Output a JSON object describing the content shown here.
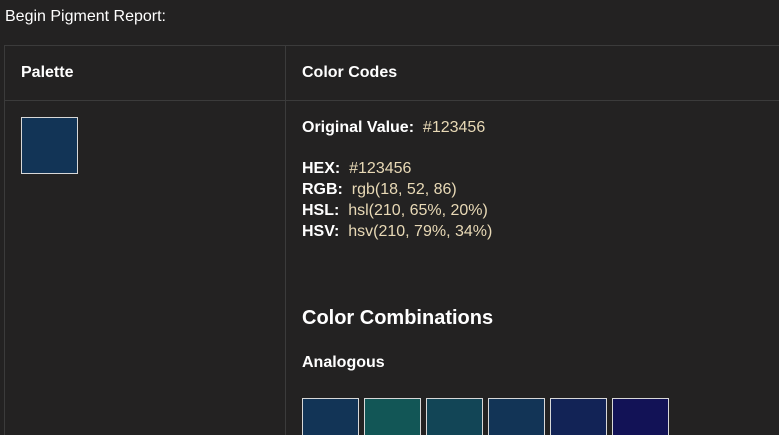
{
  "intro_text": "Begin Pigment Report:",
  "table": {
    "headers": {
      "palette": "Palette",
      "color_codes": "Color Codes"
    }
  },
  "main_color": "#123456",
  "codes": {
    "original": {
      "label": "Original Value:",
      "value": "#123456"
    },
    "hex": {
      "label": "HEX:",
      "value": "#123456"
    },
    "rgb": {
      "label": "RGB:",
      "value": "rgb(18, 52, 86)"
    },
    "hsl": {
      "label": "HSL:",
      "value": "hsl(210, 65%, 20%)"
    },
    "hsv": {
      "label": "HSV:",
      "value": "hsv(210, 79%, 34%)"
    }
  },
  "combinations": {
    "title": "Color Combinations",
    "analogous": {
      "title": "Analogous",
      "swatches": [
        "#123456",
        "#125656",
        "#124556",
        "#123456",
        "#122356",
        "#121256"
      ]
    }
  }
}
